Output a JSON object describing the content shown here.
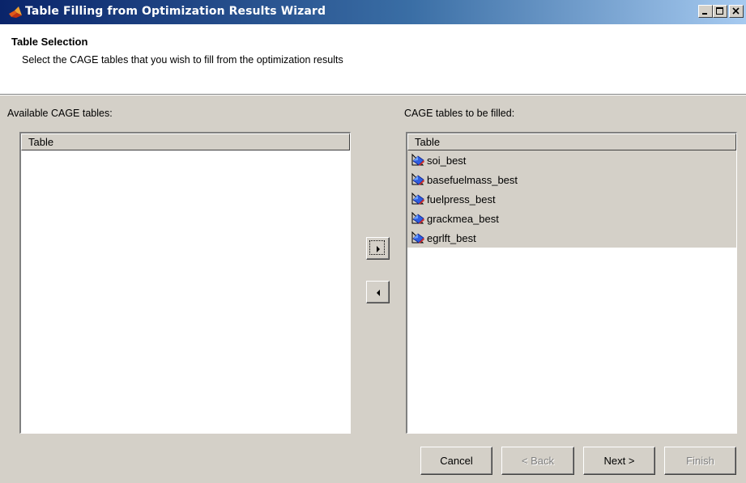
{
  "window": {
    "title": "Table Filling from Optimization Results Wizard",
    "controls": [
      "minimize-icon",
      "maximize-icon",
      "close-icon"
    ]
  },
  "header": {
    "title": "Table Selection",
    "description": "Select the CAGE tables that you wish to fill from the optimization results"
  },
  "available": {
    "label": "Available CAGE tables:",
    "column_header": "Table",
    "items": []
  },
  "selected": {
    "label": "CAGE tables to be filled:",
    "column_header": "Table",
    "items": [
      {
        "label": "soi_best",
        "icon": "table-icon"
      },
      {
        "label": "basefuelmass_best",
        "icon": "table-icon"
      },
      {
        "label": "fuelpress_best",
        "icon": "table-icon"
      },
      {
        "label": "grackmea_best",
        "icon": "table-icon"
      },
      {
        "label": "egrlft_best",
        "icon": "table-icon"
      }
    ]
  },
  "transfer": {
    "add_icon": "arrow-right-icon",
    "remove_icon": "arrow-left-icon"
  },
  "buttons": {
    "cancel": "Cancel",
    "back": "< Back",
    "next": "Next >",
    "finish": "Finish"
  },
  "colors": {
    "titlebar_start": "#0a246a",
    "titlebar_end": "#a6caf0",
    "face": "#d4d0c8"
  }
}
